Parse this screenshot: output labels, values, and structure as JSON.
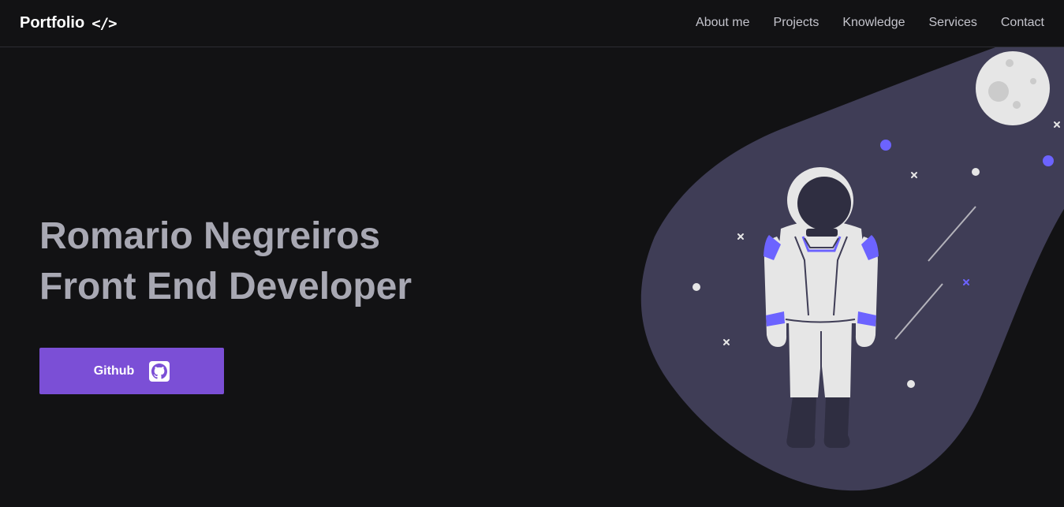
{
  "header": {
    "brand": "Portfolio",
    "brand_icon": "code-icon",
    "brand_code": "</>",
    "nav": [
      "About me",
      "Projects",
      "Knowledge",
      "Services",
      "Contact"
    ]
  },
  "hero": {
    "name": "Romario Negreiros",
    "role": "Front End Developer",
    "button_label": "Github",
    "button_icon": "github-icon"
  },
  "colors": {
    "background": "#121214",
    "heading": "#a8a8b3",
    "nav_text": "#c4c4cc",
    "button": "#7b4fd6",
    "blob": "#3f3d56",
    "accent": "#6c63ff"
  },
  "illustration": "astronaut-illustration"
}
